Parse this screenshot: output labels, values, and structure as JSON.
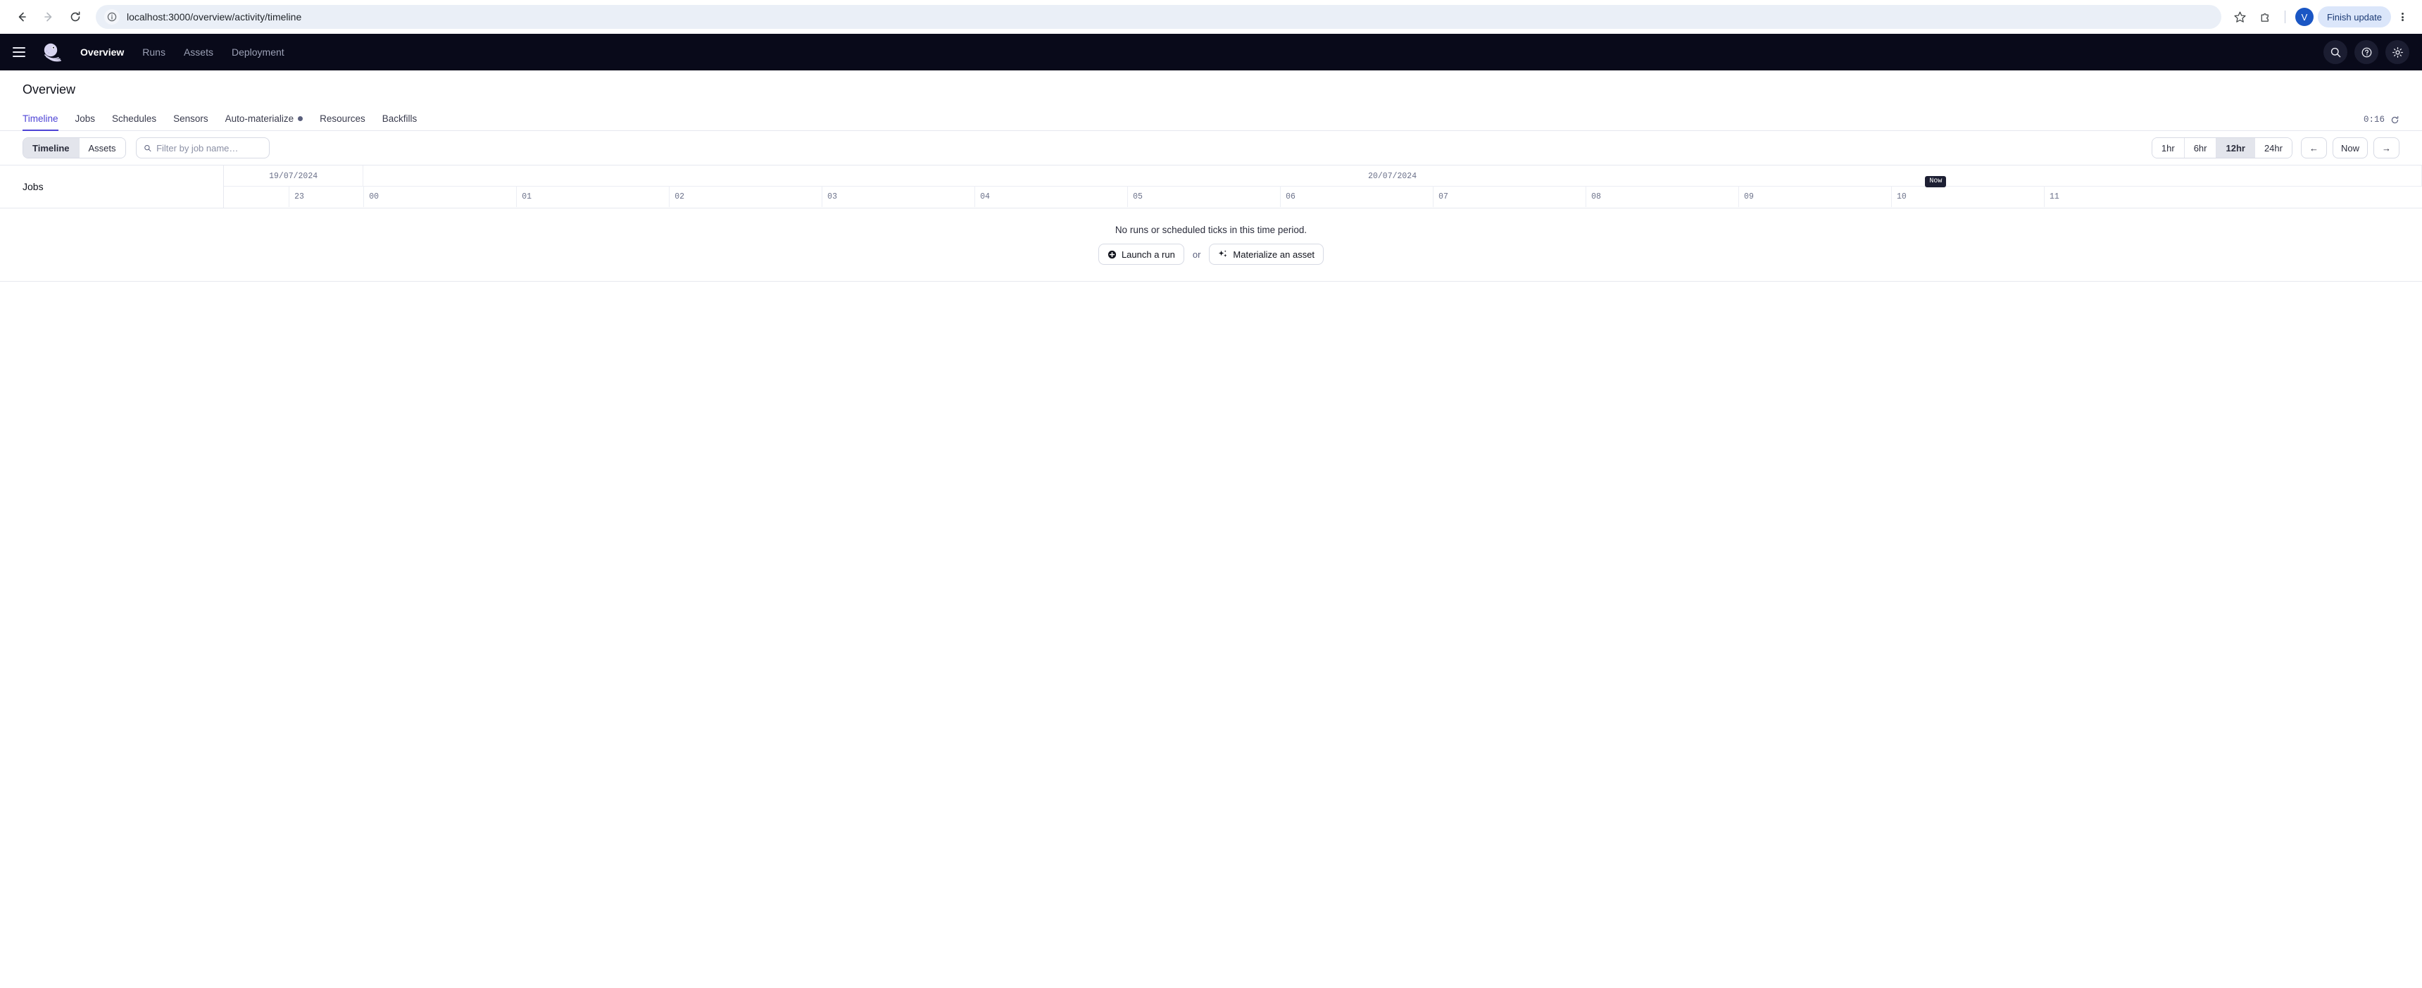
{
  "browser": {
    "back_icon": "arrow-left-icon",
    "forward_icon": "arrow-right-icon",
    "reload_icon": "reload-icon",
    "site_info_icon": "info-circle-icon",
    "url": "localhost:3000/overview/activity/timeline",
    "bookmark_icon": "star-icon",
    "extensions_icon": "extensions-puzzle-icon",
    "profile_initial": "V",
    "finish_update_label": "Finish update",
    "menu_icon": "kebab-menu-icon"
  },
  "app_header": {
    "menu_icon": "hamburger-menu-icon",
    "logo": "dagster-octopus-logo",
    "nav": [
      {
        "label": "Overview",
        "active": true
      },
      {
        "label": "Runs",
        "active": false
      },
      {
        "label": "Assets",
        "active": false
      },
      {
        "label": "Deployment",
        "active": false
      }
    ],
    "actions": [
      {
        "icon": "search-icon"
      },
      {
        "icon": "help-question-icon"
      },
      {
        "icon": "gear-settings-icon"
      }
    ]
  },
  "page": {
    "title": "Overview",
    "tabs": [
      {
        "label": "Timeline",
        "active": true,
        "dot": false
      },
      {
        "label": "Jobs",
        "active": false,
        "dot": false
      },
      {
        "label": "Schedules",
        "active": false,
        "dot": false
      },
      {
        "label": "Sensors",
        "active": false,
        "dot": false
      },
      {
        "label": "Auto-materialize",
        "active": false,
        "dot": true
      },
      {
        "label": "Resources",
        "active": false,
        "dot": false
      },
      {
        "label": "Backfills",
        "active": false,
        "dot": false
      }
    ],
    "refresh_countdown": "0:16",
    "refresh_icon": "refresh-icon"
  },
  "toolbar": {
    "view_modes": [
      {
        "label": "Timeline",
        "selected": true
      },
      {
        "label": "Assets",
        "selected": false
      }
    ],
    "search_icon": "search-icon",
    "search_value": "",
    "search_placeholder": "Filter by job name…",
    "ranges": [
      {
        "label": "1hr",
        "selected": false
      },
      {
        "label": "6hr",
        "selected": false
      },
      {
        "label": "12hr",
        "selected": true
      },
      {
        "label": "24hr",
        "selected": false
      }
    ],
    "prev_label": "←",
    "now_label": "Now",
    "next_label": "→"
  },
  "timeline": {
    "row_header": "Jobs",
    "dates": [
      {
        "label": "19/07/2024",
        "start_pct": 0,
        "end_pct": 6.35
      },
      {
        "label": "20/07/2024",
        "start_pct": 6.35,
        "end_pct": 100
      }
    ],
    "hours": [
      {
        "label": "23",
        "pos_pct": 2.95
      },
      {
        "label": "00",
        "pos_pct": 6.35
      },
      {
        "label": "01",
        "pos_pct": 13.3
      },
      {
        "label": "02",
        "pos_pct": 20.25
      },
      {
        "label": "03",
        "pos_pct": 27.2
      },
      {
        "label": "04",
        "pos_pct": 34.15
      },
      {
        "label": "05",
        "pos_pct": 41.1
      },
      {
        "label": "06",
        "pos_pct": 48.05
      },
      {
        "label": "07",
        "pos_pct": 55.0
      },
      {
        "label": "08",
        "pos_pct": 61.95
      },
      {
        "label": "09",
        "pos_pct": 68.9
      },
      {
        "label": "10",
        "pos_pct": 75.85
      },
      {
        "label": "11",
        "pos_pct": 82.8
      }
    ],
    "now_marker": {
      "label": "Now",
      "pos_pct": 77.4
    },
    "empty_message": "No runs or scheduled ticks in this time period.",
    "launch_run_icon": "plus-circle-icon",
    "launch_run_label": "Launch a run",
    "or_label": "or",
    "materialize_icon": "sparkle-icon",
    "materialize_label": "Materialize an asset"
  },
  "colors": {
    "accent": "#4e44d6",
    "header_bg": "#090a1a",
    "badge_dark": "#1d1f33",
    "chrome_update": "#dbe6fa"
  }
}
